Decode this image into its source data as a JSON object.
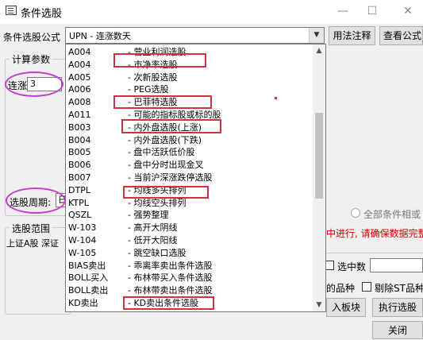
{
  "window": {
    "title": "条件选股",
    "min": "—",
    "max": "☐",
    "close": "✕"
  },
  "formula": {
    "label": "条件选股公式",
    "value": "UPN      - 连涨数天",
    "usage_btn": "用法注释",
    "view_btn": "查看公式"
  },
  "params": {
    "group_title": "计算参数",
    "label": "连涨",
    "value": "3"
  },
  "period": {
    "label": "选股周期:",
    "value": "日"
  },
  "scope": {
    "group_title": "选股范围",
    "value": "上证A股 深证"
  },
  "dropdown_items": [
    {
      "code": "A004",
      "name": "- 营业利润选股"
    },
    {
      "code": "A004",
      "name": "- 市净率选股"
    },
    {
      "code": "A005",
      "name": "- 次新股选股"
    },
    {
      "code": "A006",
      "name": "- PEG选股"
    },
    {
      "code": "A008",
      "name": "- 巴菲特选股"
    },
    {
      "code": "A011",
      "name": "- 可能的指标股或标的股"
    },
    {
      "code": "B003",
      "name": "- 内外盘选股(上涨)"
    },
    {
      "code": "B004",
      "name": "- 内外盘选股(下跌)"
    },
    {
      "code": "B005",
      "name": "- 盘中活跃低价股"
    },
    {
      "code": "B006",
      "name": "- 盘中分时出现金叉"
    },
    {
      "code": "B007",
      "name": "- 当前沪深涨跌停选股"
    },
    {
      "code": "DTPL",
      "name": "- 均线多头排列"
    },
    {
      "code": "KTPL",
      "name": "- 均线空头排列"
    },
    {
      "code": "QSZL",
      "name": "- 强势整理"
    },
    {
      "code": "W-103",
      "name": "- 高开大阴线"
    },
    {
      "code": "W-104",
      "name": "- 低开大阳线"
    },
    {
      "code": "W-105",
      "name": "- 跳空缺口选股"
    },
    {
      "code": "BIAS卖出",
      "name": "- 乖离率卖出条件选股"
    },
    {
      "code": "BOLL买入",
      "name": "- 布林带买入条件选股"
    },
    {
      "code": "BOLL卖出",
      "name": "- 布林带卖出条件选股"
    },
    {
      "code": "KD卖出",
      "name": "- KD卖出条件选股"
    }
  ],
  "right_panel": {
    "all_conditions": "全部条件相或",
    "warning": "中进行, 请确保数据完整",
    "select_count": "选中数",
    "varieties": "的品种",
    "exclude_st": "剔除ST品种",
    "add_block": "入板块",
    "run_select": "执行选股",
    "close": "关闭"
  },
  "colors": {
    "annotation_box": "#d0343a",
    "annotation_ellipse": "#c63bd1",
    "warning_text": "#cc0000"
  },
  "icons": [
    "window-icon",
    "chevron-down-icon",
    "chevron-up-icon",
    "chevron-down-icon"
  ]
}
